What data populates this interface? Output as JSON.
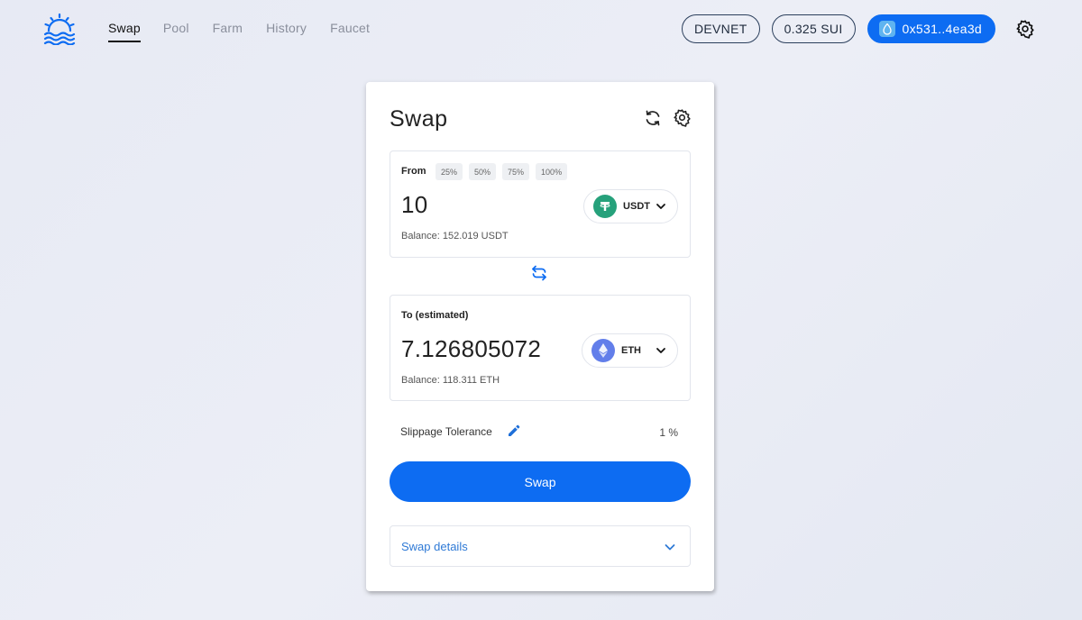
{
  "nav": {
    "items": [
      "Swap",
      "Pool",
      "Farm",
      "History",
      "Faucet"
    ],
    "active": "Swap"
  },
  "header": {
    "network": "DEVNET",
    "balance": "0.325 SUI",
    "wallet_address": "0x531..4ea3d"
  },
  "card": {
    "title": "Swap",
    "from": {
      "label": "From",
      "percent_options": [
        "25%",
        "50%",
        "75%",
        "100%"
      ],
      "amount": "10",
      "token": "USDT",
      "balance": "Balance: 152.019 USDT"
    },
    "to": {
      "label": "To (estimated)",
      "amount": "7.126805072",
      "token": "ETH",
      "balance": "Balance: 118.311 ETH"
    },
    "slippage": {
      "label": "Slippage Tolerance",
      "value": "1 %"
    },
    "swap_button": "Swap",
    "details_label": "Swap details"
  },
  "colors": {
    "accent": "#0d6cf2",
    "usdt": "#26a17b",
    "eth": "#627eea",
    "link": "#2f7ad6"
  }
}
